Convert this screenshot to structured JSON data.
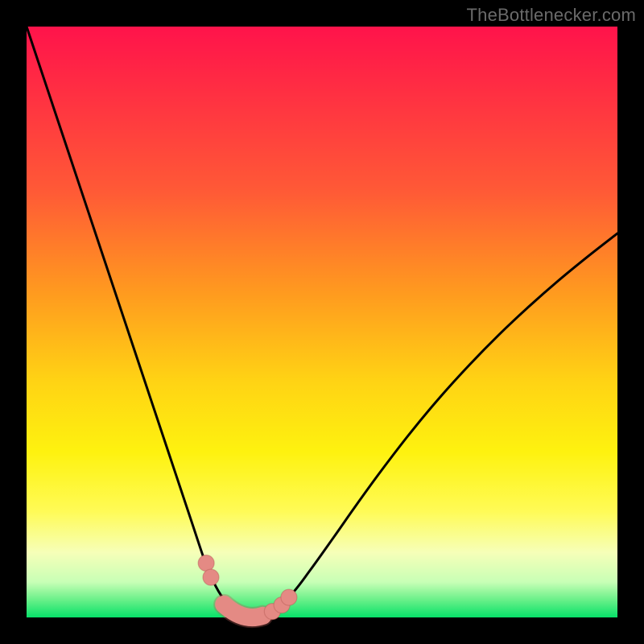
{
  "watermark": "TheBottlenecker.com",
  "colors": {
    "frame": "#000000",
    "curve": "#000000",
    "marker_fill": "#e48a84",
    "marker_stroke": "#b55a54",
    "gradient_top": "#ff134b",
    "gradient_bottom": "#07e169"
  },
  "chart_data": {
    "type": "line",
    "title": "",
    "xlabel": "",
    "ylabel": "",
    "xlim": [
      0,
      100
    ],
    "ylim": [
      0,
      100
    ],
    "x": [
      0,
      3,
      6,
      9,
      12,
      15,
      18,
      21,
      24,
      26,
      28,
      30,
      31,
      32,
      33,
      34,
      35,
      36,
      37,
      38,
      39,
      40,
      42,
      45,
      48,
      52,
      56,
      60,
      65,
      70,
      75,
      80,
      85,
      90,
      95,
      100
    ],
    "values": [
      100,
      91,
      82,
      73,
      64,
      55,
      46,
      37,
      28,
      22,
      16,
      10,
      7.5,
      5.3,
      3.6,
      2.3,
      1.3,
      0.6,
      0.15,
      0,
      0.08,
      0.3,
      1.3,
      4.1,
      8.0,
      13.6,
      19.3,
      24.8,
      31.3,
      37.3,
      42.8,
      47.9,
      52.6,
      57.0,
      61.1,
      65.0
    ],
    "series": [
      {
        "name": "bottleneck-curve",
        "x": [
          0,
          3,
          6,
          9,
          12,
          15,
          18,
          21,
          24,
          26,
          28,
          30,
          31,
          32,
          33,
          34,
          35,
          36,
          37,
          38,
          39,
          40,
          42,
          45,
          48,
          52,
          56,
          60,
          65,
          70,
          75,
          80,
          85,
          90,
          95,
          100
        ],
        "values": [
          100,
          91,
          82,
          73,
          64,
          55,
          46,
          37,
          28,
          22,
          16,
          10,
          7.5,
          5.3,
          3.6,
          2.3,
          1.3,
          0.6,
          0.15,
          0,
          0.08,
          0.3,
          1.3,
          4.1,
          8.0,
          13.6,
          19.3,
          24.8,
          31.3,
          37.3,
          42.8,
          47.9,
          52.6,
          57.0,
          61.1,
          65.0
        ]
      }
    ],
    "markers": {
      "round": [
        {
          "x": 30.4,
          "y": 9.2
        },
        {
          "x": 31.2,
          "y": 6.8
        },
        {
          "x": 41.6,
          "y": 1.0
        },
        {
          "x": 43.2,
          "y": 2.1
        },
        {
          "x": 44.4,
          "y": 3.4
        }
      ],
      "capsule": {
        "x_start": 33.4,
        "x_end": 40.0,
        "y_start": 2.2,
        "y_end": 0.3
      }
    }
  }
}
